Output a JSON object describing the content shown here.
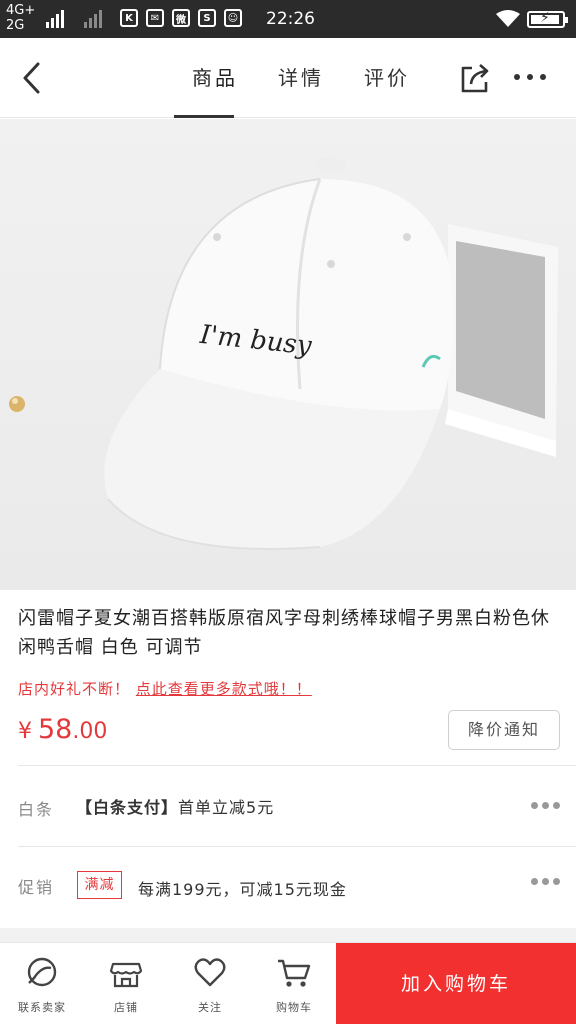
{
  "status_bar": {
    "network_top": "4G+",
    "network_bottom": "2G",
    "apps": [
      "K",
      "✉",
      "微",
      "S",
      "☺"
    ],
    "time": "22:26"
  },
  "nav": {
    "tabs": [
      {
        "label": "商品",
        "active": true
      },
      {
        "label": "详情",
        "active": false
      },
      {
        "label": "评价",
        "active": false
      }
    ]
  },
  "product": {
    "image_text": "I'm busy",
    "title": "闪雷帽子夏女潮百搭韩版原宿风字母刺绣棒球帽子男黑白粉色休闲鸭舌帽 白色 可调节",
    "promo_prefix": "店内好礼不断！",
    "promo_more": "点此查看更多款式哦！！",
    "price_currency": "¥",
    "price_int": "58",
    "price_dec": ".00",
    "notify_label": "降价通知"
  },
  "baitiao": {
    "label": "白条",
    "tag": "【白条支付】",
    "text": "首单立减5元"
  },
  "promotion": {
    "label": "促销",
    "badge": "满减",
    "text": "每满199元，可减15元现金"
  },
  "bottom_bar": {
    "contact": "联系卖家",
    "shop": "店铺",
    "follow": "关注",
    "cart": "购物车",
    "add_to_cart": "加入购物车"
  },
  "colors": {
    "accent": "#e4393c",
    "add_cart_bg": "#f23030",
    "status_bar": "#2b2b2b"
  }
}
